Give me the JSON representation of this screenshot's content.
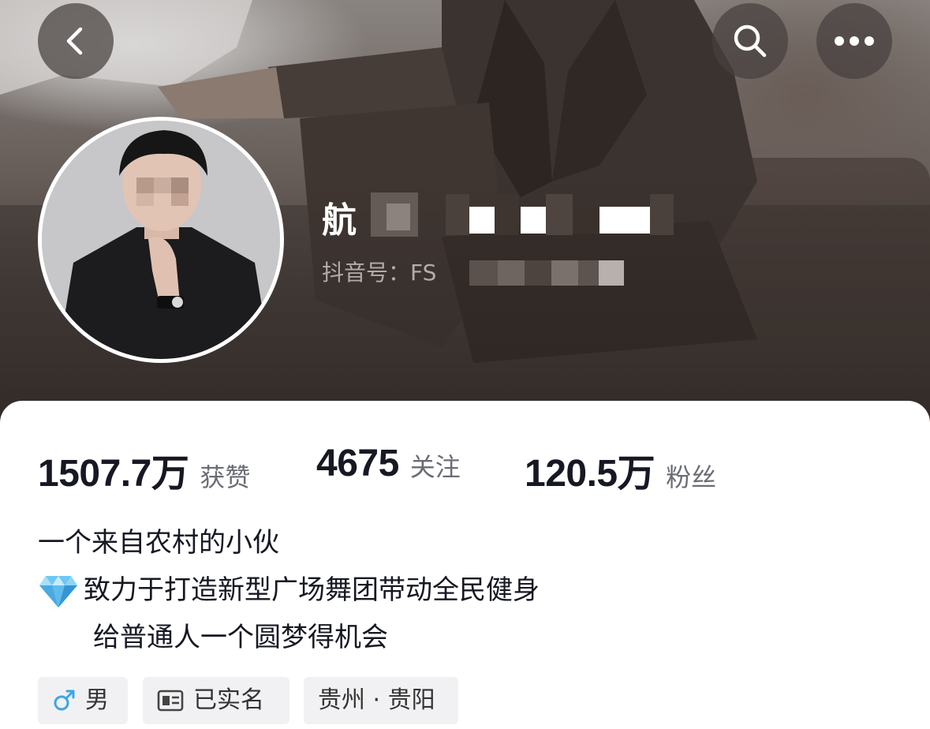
{
  "header": {
    "back_icon": "chevron-left-icon",
    "search_icon": "search-icon",
    "more_icon": "more-horizontal-icon"
  },
  "profile": {
    "username_visible": "航",
    "account_id_label": "抖音号：FS",
    "stats": [
      {
        "value": "1507.7万",
        "label": "获赞"
      },
      {
        "value": "4675",
        "label": "关注"
      },
      {
        "value": "120.5万",
        "label": "粉丝"
      }
    ],
    "bio": [
      "一个来自农村的小伙",
      "致力于打造新型广场舞团带动全民健身",
      "给普通人一个圆梦得机会"
    ],
    "tags": {
      "gender": "男",
      "verified": "已实名",
      "location": "贵州 · 贵阳"
    }
  },
  "colors": {
    "card_bg": "#ffffff",
    "text_primary": "#161823",
    "text_secondary": "#6b6d75",
    "tag_bg": "#f1f1f3",
    "gender_male": "#3aa7e6"
  }
}
